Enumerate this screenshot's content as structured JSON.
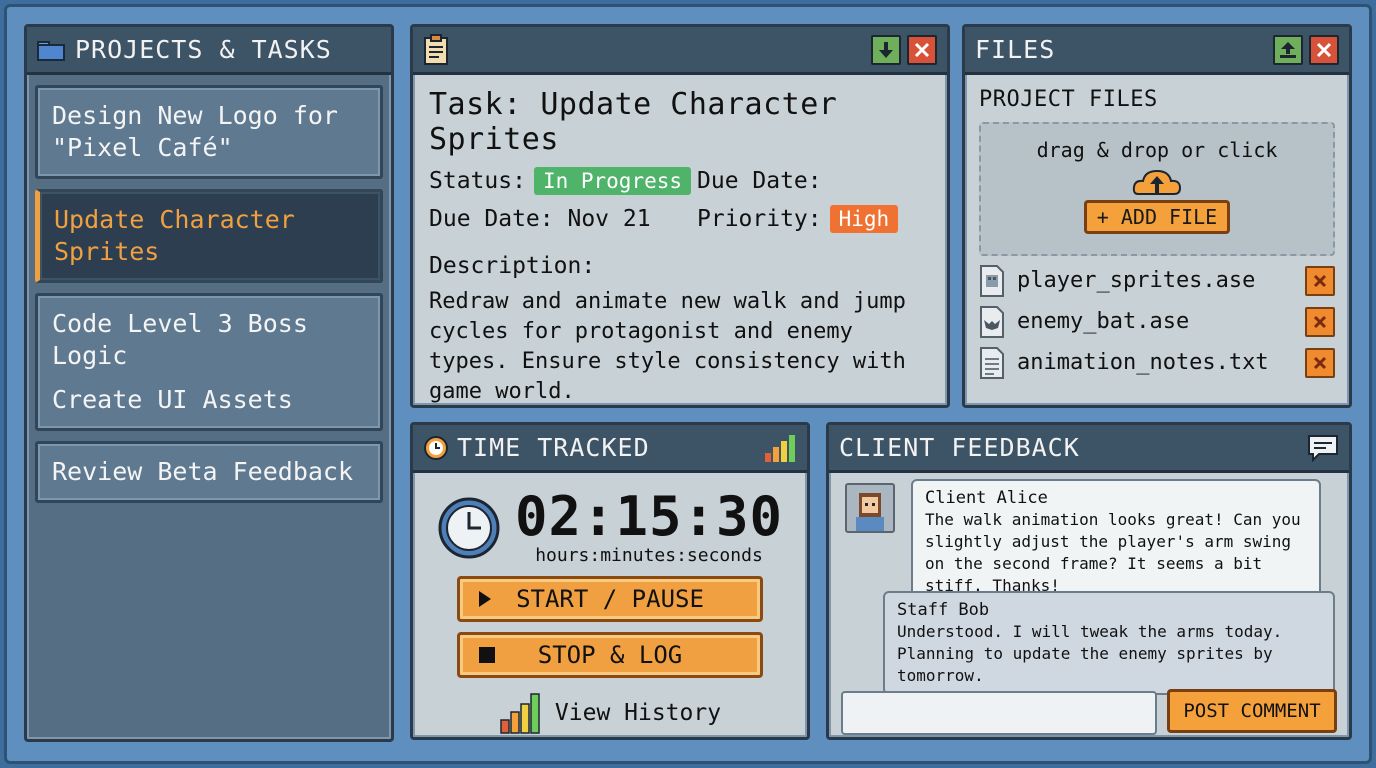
{
  "projects": {
    "title": "PROJECTS & TASKS",
    "items": [
      {
        "label": "Design New Logo for \"Pixel Café\""
      },
      {
        "label": "Update Character Sprites"
      },
      {
        "label": "Code Level 3 Boss Logic",
        "sub": "Create UI Assets"
      },
      {
        "label": "Review Beta Feedback"
      }
    ]
  },
  "task": {
    "title": "Task: Update Character Sprites",
    "status_label": "Status:",
    "status_value": "In Progress",
    "due_label": "Due Date:",
    "due_value_label": "Due Date: Nov 21",
    "priority_label": "Priority:",
    "priority_value": "High",
    "description_label": "Description:",
    "description": "Redraw and animate new walk and jump cycles for protagonist and enemy types. Ensure style consistency with game world."
  },
  "files": {
    "title": "FILES",
    "subtitle": "PROJECT FILES",
    "drop_text": "drag & drop or click",
    "add_label": "+ ADD FILE",
    "list": [
      {
        "name": "player_sprites.ase",
        "icon": "sprite-file-icon"
      },
      {
        "name": "enemy_bat.ase",
        "icon": "bat-file-icon"
      },
      {
        "name": "animation_notes.txt",
        "icon": "text-file-icon"
      }
    ]
  },
  "time": {
    "title": "TIME TRACKED",
    "readout": "02:15:30",
    "readout_units": "hours:minutes:seconds",
    "start_label": "START / PAUSE",
    "stop_label": "STOP & LOG",
    "history_label": "View History"
  },
  "feedback": {
    "title": "CLIENT FEEDBACK",
    "messages": [
      {
        "author": "Client Alice",
        "text": "The walk animation looks great! Can you slightly adjust the player's arm swing on the second frame? It seems a bit stiff. Thanks!"
      },
      {
        "author": "Staff Bob",
        "text": "Understood. I will tweak the arms today. Planning to update the enemy sprites by tomorrow."
      }
    ],
    "input_value": "",
    "post_label": "POST COMMENT"
  },
  "colors": {
    "accent": "#f0a040",
    "status_green": "#4fb36a",
    "priority_orange": "#ef7232"
  }
}
